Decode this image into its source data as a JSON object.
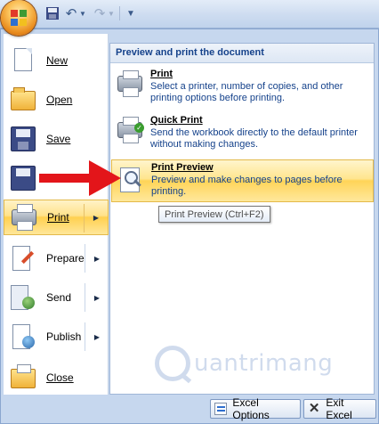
{
  "quick_access": {
    "save_icon": "save-icon",
    "undo_icon": "undo-icon",
    "redo_icon": "redo-icon",
    "customize_label": "▼"
  },
  "office_button": {
    "icon": "office-logo-icon"
  },
  "left_menu": {
    "items": [
      {
        "label": "New",
        "key": "N",
        "icon": "new-document-icon",
        "has_submenu": false
      },
      {
        "label": "Open",
        "key": "O",
        "icon": "open-folder-icon",
        "has_submenu": false
      },
      {
        "label": "Save",
        "key": "S",
        "icon": "save-icon",
        "has_submenu": false
      },
      {
        "label": "",
        "icon": "save-as-icon",
        "has_submenu": false
      },
      {
        "label": "Print",
        "key": "P",
        "icon": "printer-icon",
        "has_submenu": true,
        "active": true
      },
      {
        "label": "Prepare",
        "key": "E",
        "icon": "prepare-icon",
        "has_submenu": true
      },
      {
        "label": "Send",
        "key": "D",
        "icon": "send-icon",
        "has_submenu": true
      },
      {
        "label": "Publish",
        "key": "U",
        "icon": "publish-icon",
        "has_submenu": true
      },
      {
        "label": "Close",
        "key": "C",
        "icon": "close-folder-icon",
        "has_submenu": false
      }
    ]
  },
  "right_panel": {
    "title": "Preview and print the document",
    "options": [
      {
        "title": "Print",
        "description": "Select a printer, number of copies, and other printing options before printing.",
        "icon": "printer-icon"
      },
      {
        "title": "Quick Print",
        "description": "Send the workbook directly to the default printer without making changes.",
        "icon": "quick-print-icon"
      },
      {
        "title": "Print Preview",
        "description": "Preview and make changes to pages before printing.",
        "icon": "print-preview-icon",
        "active": true
      }
    ]
  },
  "tooltip": {
    "text": "Print Preview (Ctrl+F2)"
  },
  "watermark": {
    "text": "uantrimang"
  },
  "bottom_buttons": {
    "options_label": "Excel Options",
    "exit_label": "Exit Excel"
  },
  "colors": {
    "accent_hover": "#ffd04f",
    "menu_text": "#15428b",
    "arrow": "#e3151a"
  }
}
